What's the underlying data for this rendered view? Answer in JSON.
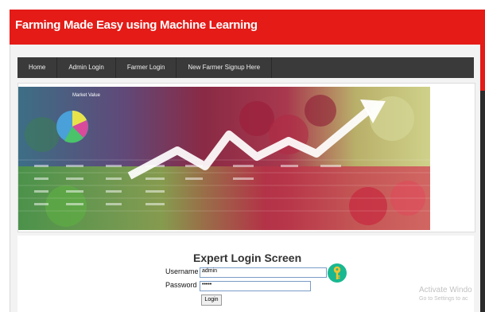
{
  "header": {
    "title": "Farming Made Easy using Machine Learning"
  },
  "nav": {
    "items": [
      "Home",
      "Admin Login",
      "Farmer Login",
      "New Farmer Signup Here"
    ]
  },
  "banner": {
    "chart_label": "Market Value"
  },
  "login": {
    "title": "Expert Login Screen",
    "username_label": "Username",
    "username_value": "admin",
    "password_label": "Password",
    "password_value": "•••••",
    "button_label": "Login"
  },
  "watermark": {
    "line1": "Activate Windo",
    "line2": "Go to Settings to ac"
  },
  "colors": {
    "header_red": "#e41b17",
    "nav_dark": "#3a3a3a",
    "key_icon": "#19b890"
  }
}
